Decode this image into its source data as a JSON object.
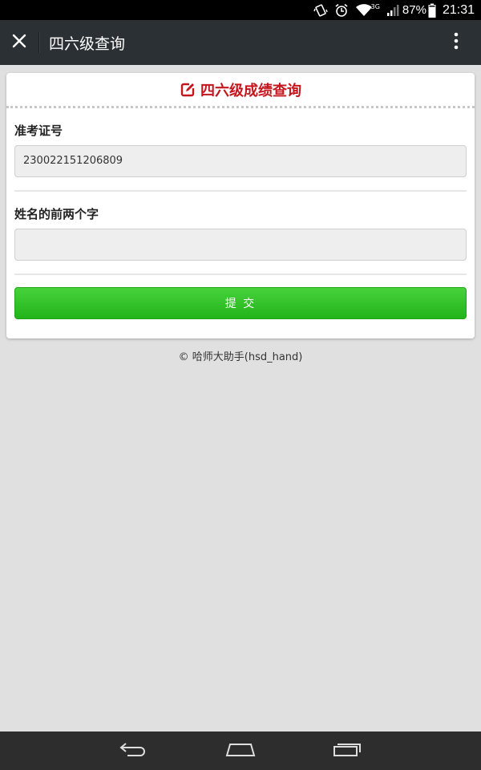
{
  "status_bar": {
    "battery": "87%",
    "time": "21:31",
    "network_label": "3G",
    "icons": [
      "vibrate-icon",
      "alarm-icon",
      "wifi-icon",
      "signal-icon",
      "battery-icon"
    ]
  },
  "title_bar": {
    "title": "四六级查询",
    "icons": [
      "close-icon",
      "more-vert-icon"
    ]
  },
  "card": {
    "title": "四六级成绩查询",
    "title_color": "#c4161c",
    "header_icon": "edit-icon",
    "fields": [
      {
        "label": "准考证号",
        "value": "230022151206809",
        "placeholder": ""
      },
      {
        "label": "姓名的前两个字",
        "value": "",
        "placeholder": ""
      }
    ],
    "submit_label": "提 交",
    "submit_color": "#2dbf24"
  },
  "footer": {
    "copyright": "© 哈师大助手(hsd_hand)"
  },
  "nav_bar": {
    "icons": [
      "back-icon",
      "home-icon",
      "recent-apps-icon"
    ]
  }
}
